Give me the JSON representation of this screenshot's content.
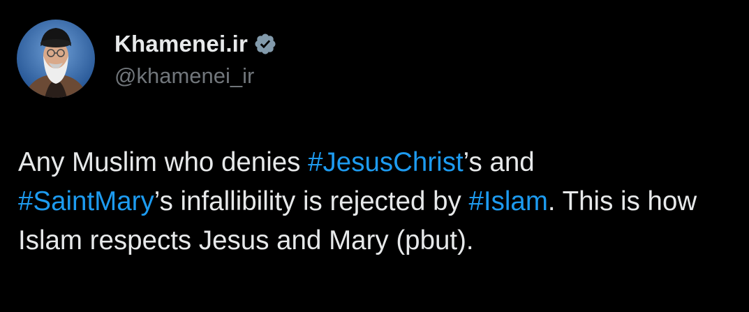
{
  "author": {
    "display_name": "Khamenei.ir",
    "handle": "@khamenei_ir",
    "verified": true,
    "avatar_icon": "profile-photo",
    "verified_icon": "verified-badge-icon"
  },
  "tweet": {
    "segments": [
      {
        "text": "Any Muslim who denies ",
        "type": "text"
      },
      {
        "text": "#JesusChrist",
        "type": "hashtag"
      },
      {
        "text": "’s and ",
        "type": "text"
      },
      {
        "text": "#SaintMary",
        "type": "hashtag"
      },
      {
        "text": "’s infallibility is rejected by ",
        "type": "text"
      },
      {
        "text": "#Islam",
        "type": "hashtag"
      },
      {
        "text": ". This is how Islam respects Jesus and Mary (pbut).",
        "type": "text"
      }
    ]
  },
  "colors": {
    "background": "#000000",
    "text": "#e7e9ea",
    "secondary_text": "#71767b",
    "link": "#1d9bf0"
  }
}
